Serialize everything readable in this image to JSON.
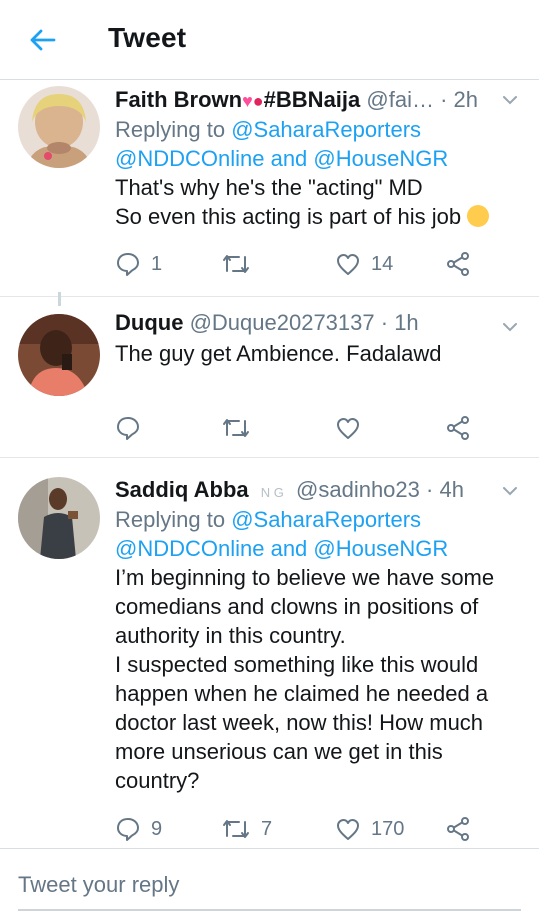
{
  "header": {
    "title": "Tweet"
  },
  "tweets": [
    {
      "name": "Faith Brown",
      "name_suffix": "#BBNaija",
      "handle": "@fai…",
      "time": "· 2h",
      "replying_prefix": "Replying to ",
      "replying_to_1": "@SaharaReporters",
      "replying_to_2": "@NDDCOnline and @HouseNGR",
      "lines": [
        "That's why he's the \"acting\" MD",
        "So even this acting is part of his job"
      ],
      "reply_count": "1",
      "retweet_count": "",
      "like_count": "14"
    },
    {
      "name": "Duque",
      "handle": "@Duque20273137",
      "time": "· 1h",
      "lines": [
        "The guy get Ambience. Fadalawd"
      ],
      "reply_count": "",
      "retweet_count": "",
      "like_count": ""
    },
    {
      "name": "Saddiq Abba",
      "flags": "N G",
      "handle": "@sadinho23",
      "time": "· 4h",
      "replying_prefix": "Replying to ",
      "replying_to_1": "@SaharaReporters",
      "replying_to_2": "@NDDCOnline and @HouseNGR",
      "lines": [
        "I’m beginning to believe we have some",
        "comedians and clowns in positions of",
        "authority in this country.",
        "I suspected something like this would",
        "happen when he claimed he needed a",
        "doctor last week, now this! How much",
        "more unserious can we get in this",
        "country?"
      ],
      "reply_count": "9",
      "retweet_count": "7",
      "like_count": "170"
    }
  ],
  "reply": {
    "placeholder": "Tweet your reply"
  },
  "colors": {
    "accent": "#1da1f2",
    "secondary": "#657786",
    "text": "#14171a"
  },
  "icons": [
    "back-arrow-icon",
    "chevron-down-icon",
    "reply-icon",
    "retweet-icon",
    "like-icon",
    "share-icon"
  ]
}
